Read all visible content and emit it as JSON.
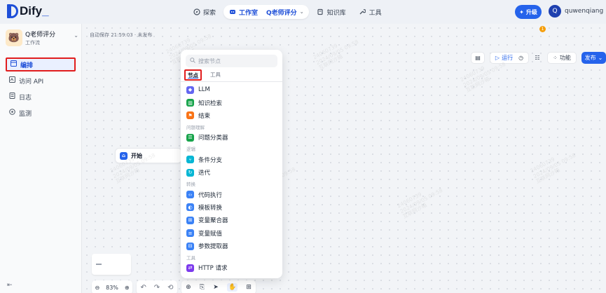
{
  "app": {
    "brand": "Dify",
    "brand_suffix": "_"
  },
  "nav": {
    "explore": "探索",
    "studio": "工作室",
    "studio_sub": "Q老师评分",
    "knowledge": "知识库",
    "tools": "工具"
  },
  "account": {
    "upgrade": "升级",
    "avatar_letter": "Q",
    "username": "quwenqiang"
  },
  "sidebar": {
    "app_name": "Q老师评分",
    "app_type": "工作流",
    "items": [
      {
        "label": "编排",
        "icon": "layout-icon"
      },
      {
        "label": "访问 API",
        "icon": "api-icon"
      },
      {
        "label": "日志",
        "icon": "log-icon"
      },
      {
        "label": "监测",
        "icon": "monitor-icon"
      }
    ]
  },
  "canvas": {
    "autosave": "自动保存 21:59:03 · 未发布",
    "start_node": "开始",
    "zoom": "83%"
  },
  "toolbar": {
    "run": "运行",
    "features": "功能",
    "publish": "发布",
    "notif_count": "1"
  },
  "block_panel": {
    "search_placeholder": "搜索节点",
    "tabs": [
      "节点",
      "工具"
    ],
    "groups": [
      {
        "title": "",
        "items": [
          {
            "label": "LLM",
            "color": "#6366f1",
            "glyph": "◆"
          },
          {
            "label": "知识检索",
            "color": "#16a34a",
            "glyph": "▥"
          },
          {
            "label": "结束",
            "color": "#f97316",
            "glyph": "⚑"
          }
        ]
      },
      {
        "title": "问题理解",
        "items": [
          {
            "label": "问题分类器",
            "color": "#16a34a",
            "glyph": "☰"
          }
        ]
      },
      {
        "title": "逻辑",
        "items": [
          {
            "label": "条件分支",
            "color": "#06b6d4",
            "glyph": "⑂"
          },
          {
            "label": "迭代",
            "color": "#06b6d4",
            "glyph": "↻"
          }
        ]
      },
      {
        "title": "转换",
        "items": [
          {
            "label": "代码执行",
            "color": "#3b82f6",
            "glyph": "‹›"
          },
          {
            "label": "模板转换",
            "color": "#3b82f6",
            "glyph": "◐"
          },
          {
            "label": "变量聚合器",
            "color": "#3b82f6",
            "glyph": "⊞"
          },
          {
            "label": "变量赋值",
            "color": "#3b82f6",
            "glyph": "≡"
          },
          {
            "label": "参数提取器",
            "color": "#3b82f6",
            "glyph": "⊟"
          }
        ]
      },
      {
        "title": "工具",
        "items": [
          {
            "label": "HTTP 请求",
            "color": "#7c3aed",
            "glyph": "⇄"
          }
        ]
      }
    ]
  },
  "watermark": {
    "lines": [
      "24060739",
      "2024/09/05 09:58",
      "互联网沙箱"
    ]
  }
}
